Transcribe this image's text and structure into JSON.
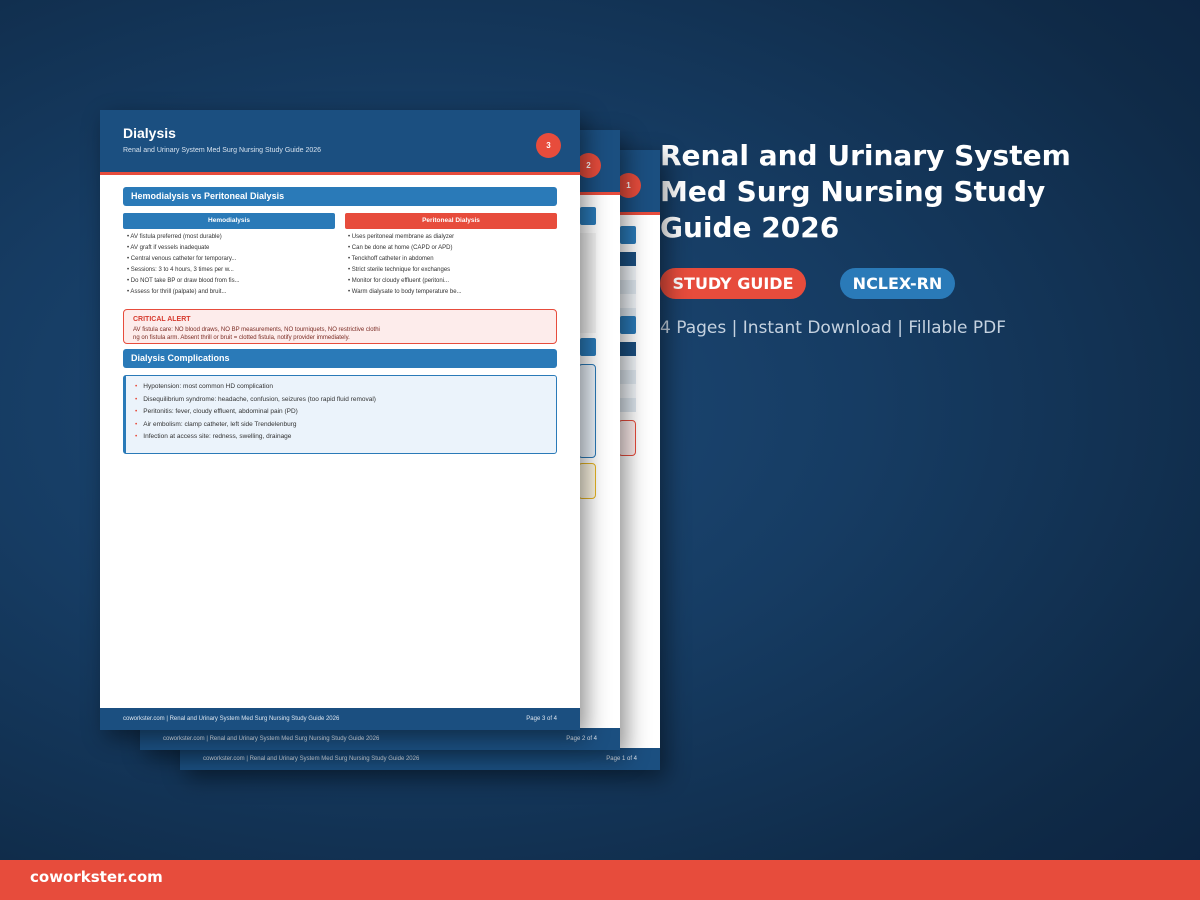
{
  "product": {
    "title": "Renal and Urinary System Med Surg Nursing Study Guide 2026",
    "badges": [
      "STUDY GUIDE",
      "NCLEX-RN"
    ],
    "meta": "4 Pages | Instant Download | Fillable PDF"
  },
  "brand": {
    "site": "coworkster.com"
  },
  "colors": {
    "accent_red": "#e74c3c",
    "header_blue": "#1b4f80",
    "section_blue": "#2a7ab8"
  },
  "pages": [
    {
      "number": "1",
      "footer_left": "coworkster.com | Renal and Urinary System Med Surg Nursing Study Guide 2026",
      "footer_right": "Page 1 of 4"
    },
    {
      "number": "2",
      "footer_left": "coworkster.com | Renal and Urinary System Med Surg Nursing Study Guide 2026",
      "footer_right": "Page 2 of 4"
    },
    {
      "number": "3",
      "title": "Dialysis",
      "subtitle": "Renal and Urinary System Med Surg Nursing Study Guide 2026",
      "section1": "Hemodialysis vs Peritoneal Dialysis",
      "col_left": {
        "header": "Hemodialysis",
        "items": [
          "• AV fistula preferred (most durable)",
          "• AV graft if vessels inadequate",
          "• Central venous catheter for temporary...",
          "• Sessions: 3 to 4 hours, 3 times per w...",
          "• Do NOT take BP or draw blood from fis...",
          "• Assess for thrill (palpate) and bruit..."
        ]
      },
      "col_right": {
        "header": "Peritoneal Dialysis",
        "items": [
          "• Uses peritoneal membrane as dialyzer",
          "• Can be done at home (CAPD or APD)",
          "• Tenckhoff catheter in abdomen",
          "• Strict sterile technique for exchanges",
          "• Monitor for cloudy effluent (peritoni...",
          "• Warm dialysate to body temperature be..."
        ]
      },
      "alert": {
        "title": "CRITICAL ALERT",
        "line1": "AV fistula care: NO blood draws, NO BP measurements, NO tourniquets, NO restrictive clothi",
        "line2": "ng on fistula arm. Absent thrill or bruit = clotted fistula, notify provider immediately."
      },
      "section2": "Dialysis Complications",
      "complications": [
        "Hypotension: most common HD complication",
        "Disequilibrium syndrome: headache, confusion, seizures (too rapid fluid removal)",
        "Peritonitis: fever, cloudy effluent, abdominal pain (PD)",
        "Air embolism: clamp catheter, left side Trendelenburg",
        "Infection at access site: redness, swelling, drainage"
      ],
      "footer_left": "coworkster.com | Renal and Urinary System Med Surg Nursing Study Guide 2026",
      "footer_right": "Page 3 of 4"
    }
  ]
}
